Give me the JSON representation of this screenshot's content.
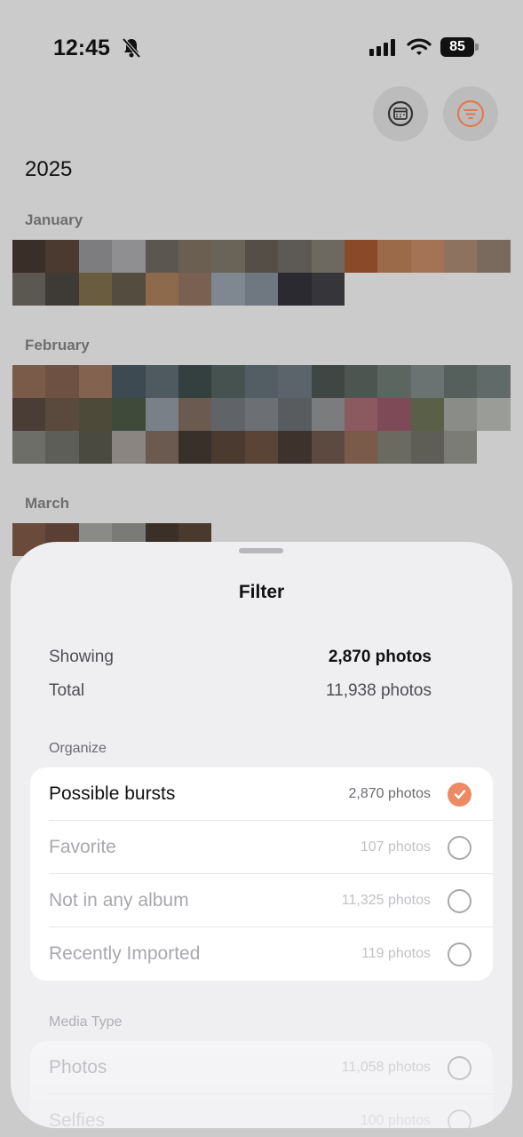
{
  "status_bar": {
    "time": "12:45",
    "battery": "85",
    "icons": [
      "bell-slash-icon",
      "cellular-signal-icon",
      "wifi-icon",
      "battery-icon"
    ]
  },
  "toolbar": {
    "buttons": [
      "calendar-icon",
      "filter-icon"
    ]
  },
  "gallery": {
    "year": "2025",
    "months": [
      {
        "label": "January"
      },
      {
        "label": "February"
      },
      {
        "label": "March"
      }
    ]
  },
  "filter_sheet": {
    "title": "Filter",
    "summary": {
      "showing_label": "Showing",
      "showing_value": "2,870 photos",
      "total_label": "Total",
      "total_value": "11,938 photos"
    },
    "organize": {
      "label": "Organize",
      "items": [
        {
          "label": "Possible bursts",
          "count": "2,870 photos",
          "selected": true
        },
        {
          "label": "Favorite",
          "count": "107 photos",
          "selected": false
        },
        {
          "label": "Not in any album",
          "count": "11,325 photos",
          "selected": false
        },
        {
          "label": "Recently Imported",
          "count": "119 photos",
          "selected": false
        }
      ]
    },
    "media_type": {
      "label": "Media Type",
      "items": [
        {
          "label": "Photos",
          "count": "11,058 photos",
          "selected": false
        },
        {
          "label": "Selfies",
          "count": "100 photos",
          "selected": false
        }
      ]
    }
  },
  "colors": {
    "accent": "#ee8a63",
    "sheet_bg": "#efeff2"
  }
}
